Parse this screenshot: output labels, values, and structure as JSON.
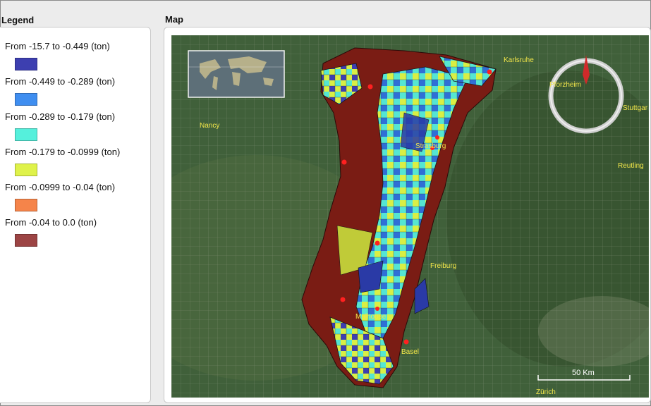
{
  "legend": {
    "title": "Legend",
    "items": [
      {
        "label": "From -15.7 to -0.449 (ton)",
        "color": "#3d3fb0"
      },
      {
        "label": "From -0.449 to -0.289 (ton)",
        "color": "#3f8ef0"
      },
      {
        "label": "From -0.289 to -0.179 (ton)",
        "color": "#55f0dc"
      },
      {
        "label": "From -0.179 to -0.0999 (ton)",
        "color": "#dff24a"
      },
      {
        "label": "From -0.0999 to -0.04 (ton)",
        "color": "#f5844a"
      },
      {
        "label": "From -0.04 to 0.0 (ton)",
        "color": "#9c4444"
      }
    ]
  },
  "map": {
    "title": "Map",
    "cities": {
      "karlsruhe": "Karlsruhe",
      "pforzheim": "Pforzheim",
      "stuttgart": "Stuttgar",
      "nancy": "Nancy",
      "strasbourg": "Strasburg",
      "reutlingen": "Reutling",
      "freiburg": "Freiburg",
      "mulhouse": "Mulhouse",
      "basel": "Basel",
      "zurich": "Zürich"
    },
    "scale_label": "50 Km",
    "compass_icon": "north-arrow-icon",
    "overview_icon": "world-overview-icon"
  }
}
